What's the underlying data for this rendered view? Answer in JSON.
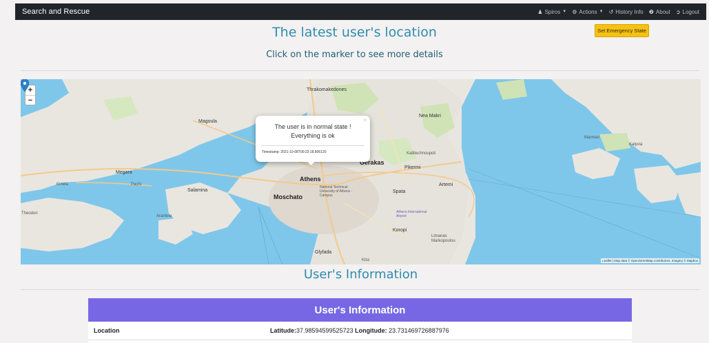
{
  "navbar": {
    "brand": "Search and Rescue",
    "items": [
      {
        "icon": "user-icon",
        "label": "Spiros",
        "dropdown": true
      },
      {
        "icon": "cogs-icon",
        "label": "Actions",
        "dropdown": true
      },
      {
        "icon": "history-icon",
        "label": "History Info",
        "dropdown": false
      },
      {
        "icon": "info-icon",
        "label": "About",
        "dropdown": false
      },
      {
        "icon": "logout-icon",
        "label": "Logout",
        "dropdown": false
      }
    ]
  },
  "header": {
    "title": "The latest user's location",
    "subtitle": "Click on the marker to see more details",
    "emergency_button": "Set Emergency State"
  },
  "map": {
    "zoom_in": "+",
    "zoom_out": "−",
    "popup": {
      "line1": "The user is in normal state !",
      "line2": "Everything is ok",
      "timestamp": "Timestamp: 2021-10-08T00:23:18.806120",
      "close": "×"
    },
    "labels": {
      "athens": "Athens",
      "moschato": "Moschato",
      "salamina": "Salamina",
      "megara": "Megara",
      "magoula": "Magoula",
      "gerakas": "Gerakas",
      "pikermi": "Pikermi",
      "spata": "Spata",
      "artemi": "Artemi",
      "koropi": "Koropi",
      "glyfada": "Glyfada",
      "nea_makri": "Nea Makri",
      "kalitechnoupoli": "Kallitechnoupoli",
      "thrakomakedones": "Thrakomakedones",
      "marmari": "Marmari",
      "kalyvia": "Kalyvia",
      "aranteia": "Aranteia",
      "kineta": "Kineta",
      "pachi": "Pachi",
      "limanas": "Limanas Markopoulou",
      "airport": "Athens International Airport",
      "ntua": "National Technical University of Athens - Campus",
      "theodori": "Theodori",
      "kitsi": "Kitsi"
    },
    "attribution": "Leaflet | Map data © OpenStreetMap contributors, Imagery © Mapbox"
  },
  "info_section": {
    "title": "User's Information",
    "card_header": "User's Information",
    "rows": [
      {
        "key": "Location",
        "lat_label": "Latitude:",
        "lat": "37.98594599525723",
        "lon_label": "Longitude:",
        "lon": "23.731469726887976"
      }
    ]
  },
  "colors": {
    "navbar_bg": "#1f2529",
    "title": "#2f8cad",
    "emergency": "#f5c114",
    "card_header": "#7867e4",
    "sea": "#7fc7ea",
    "land": "#e9e6e0",
    "marker": "#2a81cb"
  }
}
